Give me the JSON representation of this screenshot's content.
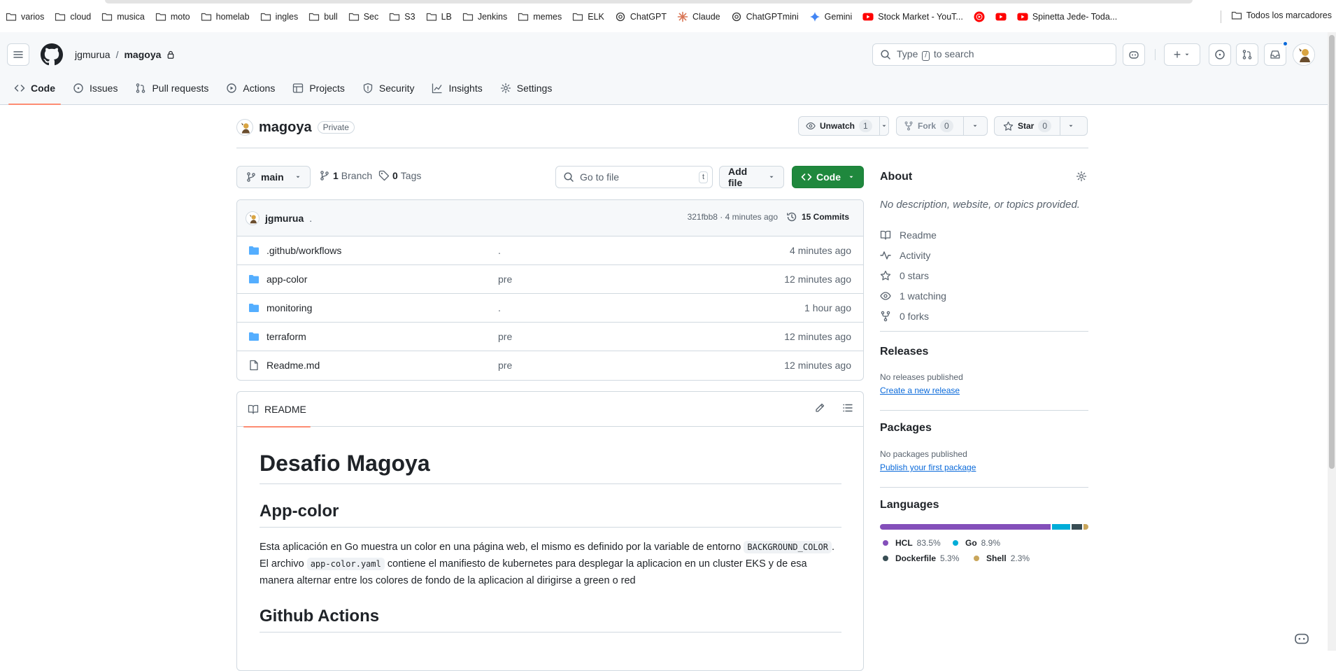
{
  "bookmarks": {
    "items": [
      {
        "label": "varios",
        "icon": "folder-icon"
      },
      {
        "label": "cloud",
        "icon": "folder-icon"
      },
      {
        "label": "musica",
        "icon": "folder-icon"
      },
      {
        "label": "moto",
        "icon": "folder-icon"
      },
      {
        "label": "homelab",
        "icon": "folder-icon"
      },
      {
        "label": "ingles",
        "icon": "folder-icon"
      },
      {
        "label": "bull",
        "icon": "folder-icon"
      },
      {
        "label": "Sec",
        "icon": "folder-icon"
      },
      {
        "label": "S3",
        "icon": "folder-icon"
      },
      {
        "label": "LB",
        "icon": "folder-icon"
      },
      {
        "label": "Jenkins",
        "icon": "folder-icon"
      },
      {
        "label": "memes",
        "icon": "folder-icon"
      },
      {
        "label": "ELK",
        "icon": "folder-icon"
      },
      {
        "label": "ChatGPT",
        "icon": "openai-icon"
      },
      {
        "label": "Claude",
        "icon": "claude-icon"
      },
      {
        "label": "ChatGPTmini",
        "icon": "openai-icon"
      },
      {
        "label": "Gemini",
        "icon": "gemini-icon"
      },
      {
        "label": "Stock Market - YouT...",
        "icon": "youtube-icon"
      },
      {
        "label": "",
        "icon": "youtube-music-icon"
      },
      {
        "label": "",
        "icon": "youtube-icon"
      },
      {
        "label": "Spinetta Jede- Toda...",
        "icon": "youtube-icon"
      }
    ],
    "all_label": "Todos los marcadores"
  },
  "header": {
    "owner": "jgmurua",
    "separator": "/",
    "repo": "magoya",
    "search_prefix": "Type",
    "search_key": "/",
    "search_suffix": "to search",
    "plus_label": "+"
  },
  "tabs": [
    {
      "label": "Code",
      "icon": "code-icon",
      "active": true
    },
    {
      "label": "Issues",
      "icon": "issue-icon"
    },
    {
      "label": "Pull requests",
      "icon": "pull-request-icon"
    },
    {
      "label": "Actions",
      "icon": "play-icon"
    },
    {
      "label": "Projects",
      "icon": "table-icon"
    },
    {
      "label": "Security",
      "icon": "shield-icon"
    },
    {
      "label": "Insights",
      "icon": "graph-icon"
    },
    {
      "label": "Settings",
      "icon": "gear-icon"
    }
  ],
  "repo": {
    "name": "magoya",
    "visibility": "Private",
    "unwatch_label": "Unwatch",
    "watch_count": "1",
    "fork_label": "Fork",
    "fork_count": "0",
    "star_label": "Star",
    "star_count": "0"
  },
  "toolbar": {
    "branch": "main",
    "branches_count": "1",
    "branches_label": "Branch",
    "tags_count": "0",
    "tags_label": "Tags",
    "goto_placeholder": "Go to file",
    "goto_key": "t",
    "add_file": "Add file",
    "code_button": "Code"
  },
  "latest_commit": {
    "user": "jgmurua",
    "message": ".",
    "hash_time": "321fbb8 · 4 minutes ago",
    "commits_count": "15",
    "commits_label": "Commits"
  },
  "files": [
    {
      "name": ".github/workflows",
      "type": "folder",
      "message": ".",
      "age": "4 minutes ago"
    },
    {
      "name": "app-color",
      "type": "folder",
      "message": "pre",
      "age": "12 minutes ago"
    },
    {
      "name": "monitoring",
      "type": "folder",
      "message": ".",
      "age": "1 hour ago"
    },
    {
      "name": "terraform",
      "type": "folder",
      "message": "pre",
      "age": "12 minutes ago"
    },
    {
      "name": "Readme.md",
      "type": "file",
      "message": "pre",
      "age": "12 minutes ago"
    }
  ],
  "readme": {
    "tab_label": "README",
    "h1": "Desafio Magoya",
    "h2_app": "App-color",
    "p1_a": "Esta aplicación en Go muestra un color en una página web, el mismo es definido por la variable de entorno",
    "p1_code1": "BACKGROUND_COLOR",
    "p1_b": ". El archivo",
    "p1_code2": "app-color.yaml",
    "p1_c": "contiene el manifiesto de kubernetes para desplegar la aplicacion en un cluster EKS y de esa manera alternar entre los colores de fondo de la aplicacion al dirigirse a green o red",
    "h2_actions": "Github Actions"
  },
  "sidebar": {
    "about_title": "About",
    "about_desc": "No description, website, or topics provided.",
    "about_items": [
      {
        "icon": "book-icon",
        "label": "Readme"
      },
      {
        "icon": "pulse-icon",
        "label": "Activity"
      },
      {
        "icon": "star-icon",
        "label": "0 stars"
      },
      {
        "icon": "eye-icon",
        "label": "1 watching"
      },
      {
        "icon": "fork-icon",
        "label": "0 forks"
      }
    ],
    "releases_title": "Releases",
    "releases_empty": "No releases published",
    "releases_link": "Create a new release",
    "packages_title": "Packages",
    "packages_empty": "No packages published",
    "packages_link": "Publish your first package",
    "languages_title": "Languages",
    "languages": [
      {
        "name": "HCL",
        "percent": "83.5%",
        "value": 83.5,
        "color": "#844fba"
      },
      {
        "name": "Go",
        "percent": "8.9%",
        "value": 8.9,
        "color": "#00add8"
      },
      {
        "name": "Dockerfile",
        "percent": "5.3%",
        "value": 5.3,
        "color": "#384d54"
      },
      {
        "name": "Shell",
        "percent": "2.3%",
        "value": 2.3,
        "color": "#c9a65b"
      }
    ]
  },
  "colors": {
    "accent": "#fd8c73",
    "link": "#0969da",
    "green_button": "#1f883d",
    "folder": "#54aeff"
  }
}
